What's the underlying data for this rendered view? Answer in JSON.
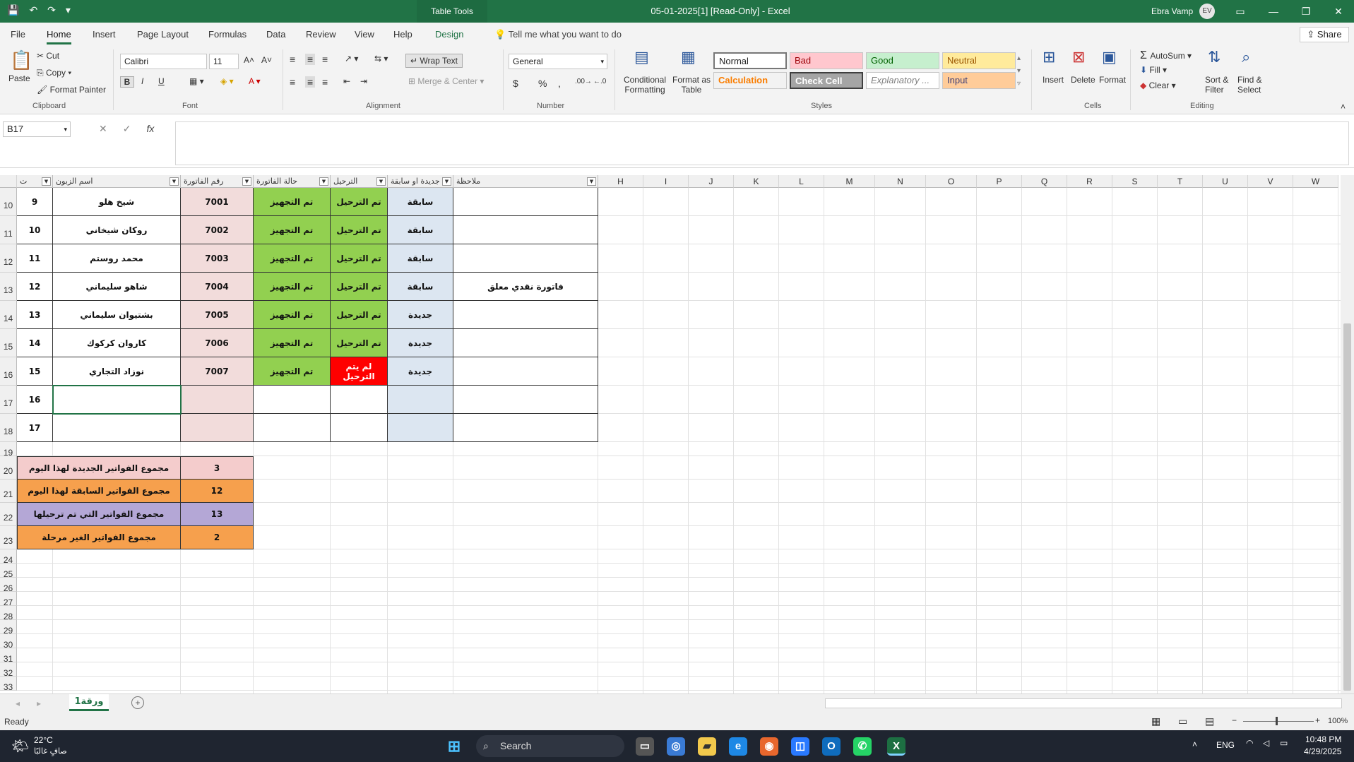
{
  "titlebar": {
    "context_tab": "Table Tools",
    "title": "05-01-2025[1]  [Read-Only]  -  Excel",
    "user_name": "Ebra Vamp",
    "user_initials": "EV"
  },
  "menu_tabs": [
    "File",
    "Home",
    "Insert",
    "Page Layout",
    "Formulas",
    "Data",
    "Review",
    "View",
    "Help",
    "Design"
  ],
  "tell_me": "Tell me what you want to do",
  "share": "Share",
  "ribbon": {
    "clipboard": {
      "paste": "Paste",
      "cut": "Cut",
      "copy": "Copy",
      "format_painter": "Format Painter",
      "label": "Clipboard"
    },
    "font": {
      "name": "Calibri",
      "size": "11",
      "label": "Font",
      "bold": "B",
      "italic": "I",
      "underline": "U"
    },
    "alignment": {
      "wrap_text": "Wrap Text",
      "merge_center": "Merge & Center",
      "label": "Alignment"
    },
    "number": {
      "format": "General",
      "label": "Number",
      "currency": "$",
      "percent": "%",
      "comma": ","
    },
    "styles": {
      "conditional": "Conditional Formatting",
      "format_as_table": "Format as Table",
      "normal": "Normal",
      "bad": "Bad",
      "good": "Good",
      "neutral": "Neutral",
      "calculation": "Calculation",
      "check_cell": "Check Cell",
      "explanatory": "Explanatory ...",
      "input": "Input",
      "label": "Styles"
    },
    "cells": {
      "insert": "Insert",
      "delete": "Delete",
      "format": "Format",
      "label": "Cells"
    },
    "editing": {
      "autosum": "AutoSum",
      "fill": "Fill",
      "clear": "Clear",
      "sort_filter": "Sort & Filter",
      "find_select": "Find & Select",
      "label": "Editing"
    }
  },
  "formula_bar": {
    "name_box": "B17",
    "formula": "",
    "fx": "fx"
  },
  "columns": [
    "H",
    "I",
    "J",
    "K",
    "L",
    "M",
    "N",
    "O",
    "P",
    "Q",
    "R",
    "S",
    "T",
    "U",
    "V",
    "W"
  ],
  "table_headers": {
    "seq": "ت",
    "customer": "اسم الزبون",
    "invoice_no": "رقم الفاتورة",
    "invoice_status": "حالة الفاتورة",
    "shipping": "الترحيل",
    "new_or_old": "جديدة او سابقة",
    "note": "ملاحظة"
  },
  "rows": [
    {
      "row": "10",
      "seq": "9",
      "customer": "شيخ هلو",
      "invoice": "7001",
      "status": "تم التجهيز",
      "ship": "تم الترحيل",
      "type": "سابقة",
      "note": ""
    },
    {
      "row": "11",
      "seq": "10",
      "customer": "روكان شيخاني",
      "invoice": "7002",
      "status": "تم التجهيز",
      "ship": "تم الترحيل",
      "type": "سابقة",
      "note": ""
    },
    {
      "row": "12",
      "seq": "11",
      "customer": "محمد روستم",
      "invoice": "7003",
      "status": "تم التجهيز",
      "ship": "تم الترحيل",
      "type": "سابقة",
      "note": ""
    },
    {
      "row": "13",
      "seq": "12",
      "customer": "شاهو سليماني",
      "invoice": "7004",
      "status": "تم التجهيز",
      "ship": "تم الترحيل",
      "type": "سابقة",
      "note": "فاتورة نقدي معلق"
    },
    {
      "row": "14",
      "seq": "13",
      "customer": "بشتيوان سليماني",
      "invoice": "7005",
      "status": "تم التجهيز",
      "ship": "تم الترحيل",
      "type": "جديدة",
      "note": ""
    },
    {
      "row": "15",
      "seq": "14",
      "customer": "كاروان كركوك",
      "invoice": "7006",
      "status": "تم التجهيز",
      "ship": "تم الترحيل",
      "type": "جديدة",
      "note": ""
    },
    {
      "row": "16",
      "seq": "15",
      "customer": "نوزاد التجاري",
      "invoice": "7007",
      "status": "تم التجهيز",
      "ship": "لم يتم الترحيل",
      "type": "جديدة",
      "note": ""
    },
    {
      "row": "17",
      "seq": "16",
      "customer": "",
      "invoice": "",
      "status": "",
      "ship": "",
      "type": "",
      "note": ""
    },
    {
      "row": "18",
      "seq": "17",
      "customer": "",
      "invoice": "",
      "status": "",
      "ship": "",
      "type": "",
      "note": ""
    }
  ],
  "summary": [
    {
      "row": "20",
      "label": "مجموع الفواتير الجديدة لهذا اليوم",
      "value": "3",
      "color": "#f4cccc"
    },
    {
      "row": "21",
      "label": "مجموع الفواتير السابقة لهذا اليوم",
      "value": "12",
      "color": "#f6a04d"
    },
    {
      "row": "22",
      "label": "مجموع الفواتير التي تم ترحيلها",
      "value": "13",
      "color": "#b4a7d6"
    },
    {
      "row": "23",
      "label": "مجموع الفواتير الغير مرحلة",
      "value": "2",
      "color": "#f6a04d"
    }
  ],
  "empty_rows": [
    "19",
    "24",
    "25",
    "26",
    "27",
    "28",
    "29",
    "30",
    "31",
    "32",
    "33"
  ],
  "sheet": {
    "tab": "ورقة1",
    "add": "+"
  },
  "status": {
    "ready": "Ready",
    "zoom": "100%"
  },
  "taskbar": {
    "weather_temp": "22°C",
    "weather_desc": "صافٍ غالبًا",
    "search": "Search",
    "lang": "ENG",
    "time": "10:48 PM",
    "date": "4/29/2025"
  },
  "colors": {
    "excel_green": "#217346",
    "green_cell": "#92d050",
    "red_cell": "#ff0000",
    "blue_cell": "#dce6f1",
    "pink_cell": "#f2dcdb"
  }
}
